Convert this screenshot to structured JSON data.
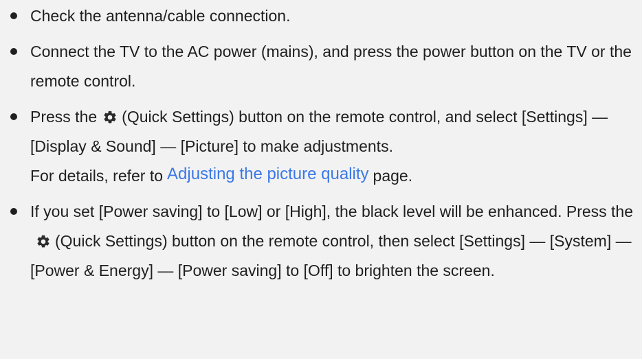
{
  "items": [
    {
      "text": "Check the antenna/cable connection."
    },
    {
      "text": "Connect the TV to the AC power (mains), and press the power button on the TV or the remote control."
    },
    {
      "pre_icon": "Press the",
      "icon": "gear-icon",
      "post_icon": "(Quick Settings) button on the remote control, and select [Settings] — [Display & Sound] — [Picture] to make adjustments.",
      "detail_pre": "For details, refer to",
      "link_text": "Adjusting the picture quality",
      "detail_post": "page."
    },
    {
      "pre_icon": "If you set [Power saving] to [Low] or [High], the black level will be enhanced. Press the",
      "icon": "gear-icon",
      "post_icon": "(Quick Settings) button on the remote control, then select [Settings] — [System] — [Power & Energy] — [Power saving] to [Off] to brighten the screen."
    }
  ],
  "colors": {
    "background": "#f2f2f2",
    "text": "#1f1f1f",
    "link": "#3b78e7"
  }
}
